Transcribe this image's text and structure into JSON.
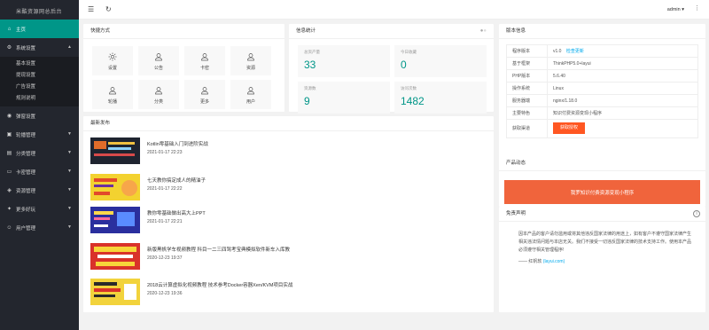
{
  "app": {
    "title": "米酷资源网总后台"
  },
  "header": {
    "user": "admin ▾"
  },
  "sidebar": {
    "home": "主页",
    "system": "系统设置",
    "system_sub": [
      "基本设置",
      "提现设置",
      "广告设置",
      "规则说明"
    ],
    "items": [
      "弹窗设置",
      "轮播管理",
      "分类管理",
      "卡密管理",
      "资源管理",
      "更多好玩",
      "用户管理"
    ]
  },
  "quick": {
    "title": "快捷方式",
    "items": [
      {
        "label": "设置",
        "icon": "gear-icon"
      },
      {
        "label": "公告",
        "icon": "user-icon"
      },
      {
        "label": "卡密",
        "icon": "user-icon"
      },
      {
        "label": "资源",
        "icon": "user-icon"
      },
      {
        "label": "轮播",
        "icon": "user-icon"
      },
      {
        "label": "分类",
        "icon": "user-icon"
      },
      {
        "label": "更多",
        "icon": "user-icon"
      },
      {
        "label": "用户",
        "icon": "user-icon"
      }
    ]
  },
  "stats": {
    "title": "信息统计",
    "items": [
      {
        "label": "总资产量",
        "value": "33"
      },
      {
        "label": "今日收藏",
        "value": "0"
      },
      {
        "label": "资源数",
        "value": "9"
      },
      {
        "label": "访问次数",
        "value": "1482"
      }
    ]
  },
  "news": {
    "title": "最新发布",
    "items": [
      {
        "title": "Kotlin零基础入门到进阶实战",
        "date": "2021-01-17 22:23"
      },
      {
        "title": "七天教你搞定成人的精油子",
        "date": "2021-01-17 22:22"
      },
      {
        "title": "教你零基础做出高大上PPT",
        "date": "2021-01-17 22:21"
      },
      {
        "title": "新版黑帆学车视频教程 科目一二三四驾考宝典模拟软件新车入库教",
        "date": "2020-12-23 19:37"
      },
      {
        "title": "2018云计算虚拟化视频教程 技术参考Docker容器Xen/KVM项目实战",
        "date": "2020-12-23 19:36"
      }
    ]
  },
  "version": {
    "title": "版本信息",
    "rows": [
      {
        "k": "程序版本",
        "v": "v1.0",
        "link": "检查更新"
      },
      {
        "k": "基于框架",
        "v": "ThinkPHP5.0+layui"
      },
      {
        "k": "PHP版本",
        "v": "5.6.40"
      },
      {
        "k": "操作系统",
        "v": "Linux"
      },
      {
        "k": "服务器端",
        "v": "nginx/1.18.0"
      },
      {
        "k": "主要特色",
        "v": "知识付费资源变现小程序"
      }
    ],
    "auth_label": "获取渠道",
    "auth_button": "获取授权"
  },
  "dynamic": {
    "title": "产品动态",
    "banner": "我罗知识付费资源变现小程序"
  },
  "disclaimer": {
    "title": "免责声明",
    "text": "因本产品的客户请勿滥用或将其他违反国家法律的用途上，如有客户不遵守国家法律产生相关违法情问题与本店无关。我们不接受一切违反国家法律的技术支持工作。使用本产品必须遵守相关管理程序!",
    "sign_prefix": "—— 红帆软",
    "sign_link": "(layui.com)"
  }
}
